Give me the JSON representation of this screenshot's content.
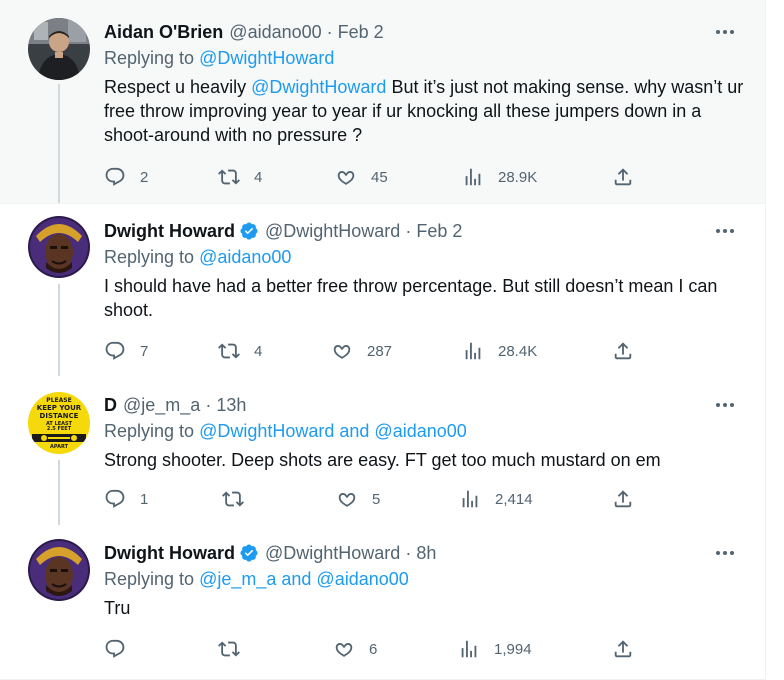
{
  "tweets": [
    {
      "name": "Aidan O'Brien",
      "handle": "@aidano00",
      "time": "Feb 2",
      "verified": false,
      "reply_prefix": "Replying to",
      "reply_to": "@DwightHoward",
      "reply_to_extra": "",
      "body_mention": "@DwightHoward",
      "body_pre": "Respect u heavily",
      "body_post": "But it’s just not making sense. why wasn’t ur free throw improving year to year if ur knocking all these jumpers down in a shoot-around with no pressure ?",
      "replies": "2",
      "retweets": "4",
      "likes": "45",
      "views": "28.9K"
    },
    {
      "name": "Dwight Howard",
      "handle": "@DwightHoward",
      "time": "Feb 2",
      "verified": true,
      "reply_prefix": "Replying to",
      "reply_to": "@aidano00",
      "reply_to_extra": "",
      "body": "I should have had a better free throw percentage. But still doesn’t mean I can shoot.",
      "replies": "7",
      "retweets": "4",
      "likes": "287",
      "views": "28.4K"
    },
    {
      "name": "D",
      "handle": "@je_m_a",
      "time": "13h",
      "verified": false,
      "reply_prefix": "Replying to",
      "reply_to": "@DwightHoward and @aidano00",
      "body": "Strong shooter. Deep shots are easy. FT get too much mustard on em",
      "replies": "1",
      "retweets": "",
      "likes": "5",
      "views": "2,414",
      "avatar_sign": {
        "line1": "PLEASE",
        "line2": "KEEP YOUR",
        "line3": "DISTANCE",
        "line4": "AT LEAST",
        "line5": "2.5 FEET",
        "line6": "APART"
      }
    },
    {
      "name": "Dwight Howard",
      "handle": "@DwightHoward",
      "time": "8h",
      "verified": true,
      "reply_prefix": "Replying to",
      "reply_to": "@je_m_a and @aidano00",
      "body": "Tru",
      "replies": "",
      "retweets": "",
      "likes": "6",
      "views": "1,994"
    }
  ],
  "icons": {
    "reply": "reply-icon",
    "retweet": "retweet-icon",
    "like": "heart-icon",
    "views": "views-icon",
    "share": "share-icon",
    "more": "more-icon",
    "verified": "verified-badge-icon"
  },
  "colors": {
    "link": "#1d9bf0",
    "muted": "#536471",
    "text": "#0f1419",
    "highlight_bg": "#f7f9f9",
    "thread_line": "#cfd9de",
    "sign_yellow": "#f5d90a"
  }
}
